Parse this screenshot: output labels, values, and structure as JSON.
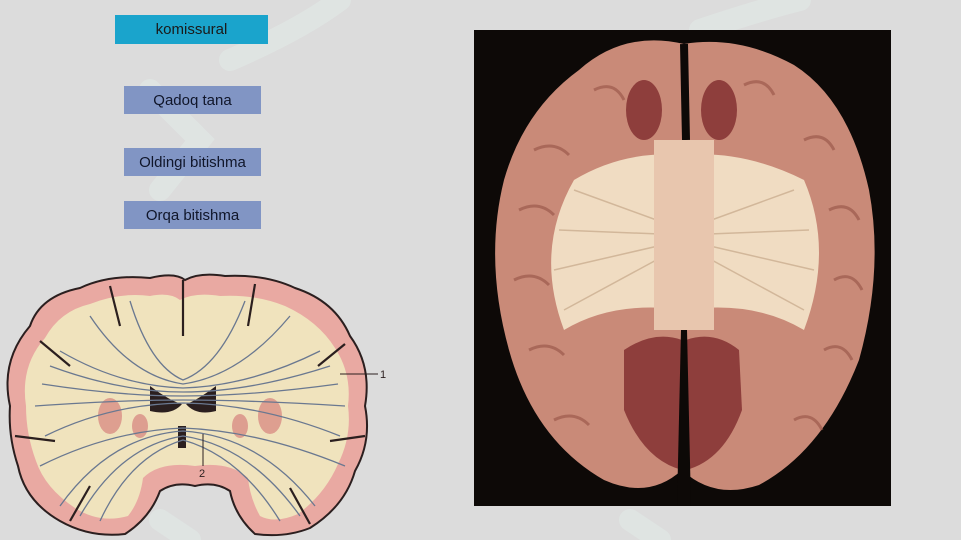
{
  "slide": {
    "title": "komissural",
    "terms": [
      "Qadoq tana",
      "Oldingi bitishma",
      "Orqa bitishma"
    ]
  },
  "diagram": {
    "label_1": "1",
    "label_2": "2"
  },
  "colors": {
    "background": "#dcdcdc",
    "title_box": "#1aa4cc",
    "term_box": "#8195c4",
    "white_matter": "#f0e3bd",
    "gray_matter": "#e9a9a2",
    "fibers": "#6a7890"
  }
}
